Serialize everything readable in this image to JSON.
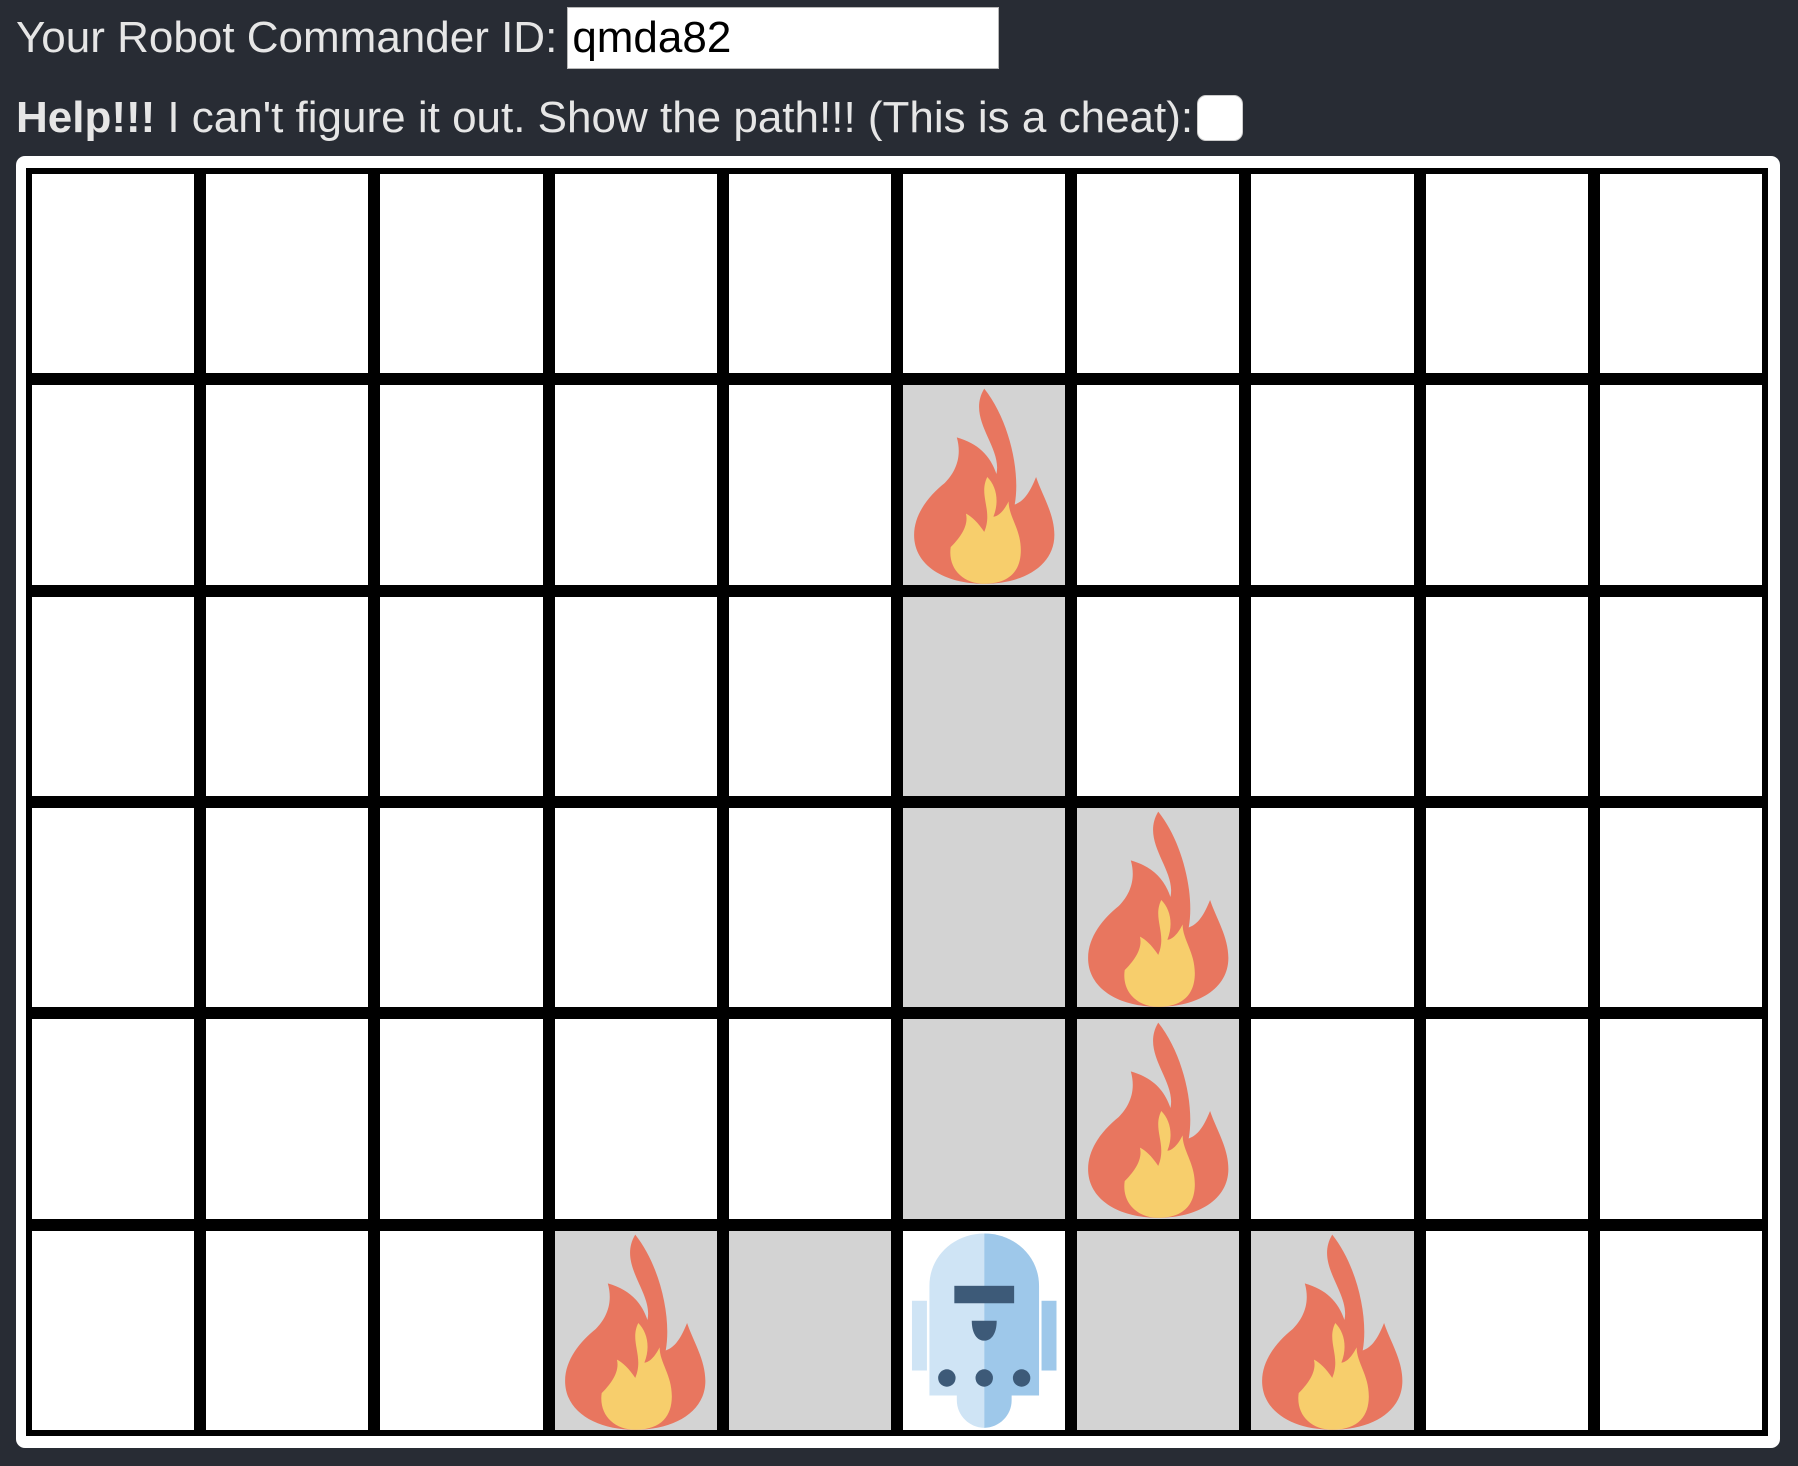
{
  "commander": {
    "label": "Your Robot Commander ID:",
    "id_value": "qmda82"
  },
  "help": {
    "strong": "Help!!!",
    "text": "I can't figure it out. Show the path!!! (This is a cheat):",
    "checked": false
  },
  "board": {
    "rows": 6,
    "cols": 10,
    "cells": [
      [
        "empty",
        "empty",
        "empty",
        "empty",
        "empty",
        "empty",
        "empty",
        "empty",
        "empty",
        "empty"
      ],
      [
        "empty",
        "empty",
        "empty",
        "empty",
        "empty",
        "fire",
        "empty",
        "empty",
        "empty",
        "empty"
      ],
      [
        "empty",
        "empty",
        "empty",
        "empty",
        "empty",
        "path",
        "empty",
        "empty",
        "empty",
        "empty"
      ],
      [
        "empty",
        "empty",
        "empty",
        "empty",
        "empty",
        "path",
        "fire",
        "empty",
        "empty",
        "empty"
      ],
      [
        "empty",
        "empty",
        "empty",
        "empty",
        "empty",
        "path",
        "fire",
        "empty",
        "empty",
        "empty"
      ],
      [
        "empty",
        "empty",
        "empty",
        "fire",
        "path",
        "robot",
        "path",
        "fire",
        "empty",
        "empty"
      ]
    ],
    "icons": {
      "fire": "fire-icon",
      "robot": "robot-icon"
    },
    "colors": {
      "cell": "#ffffff",
      "path": "#d3d3d3",
      "grid_lines": "#000000",
      "fire_outer": "#e8765f",
      "fire_inner": "#f7ce6c",
      "robot_light": "#cfe4f5",
      "robot_dark": "#9ec8ea",
      "robot_features": "#3d5a78"
    }
  }
}
